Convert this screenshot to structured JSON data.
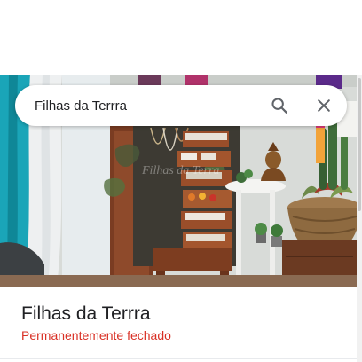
{
  "search": {
    "query": "Filhas da Terrra",
    "search_icon": "search-icon",
    "close_icon": "close-icon"
  },
  "photo": {
    "sign_text": "Filhas da Terra"
  },
  "place": {
    "title": "Filhas da Terrra",
    "status": "Permanentemente fechado",
    "status_color": "#d93025"
  }
}
